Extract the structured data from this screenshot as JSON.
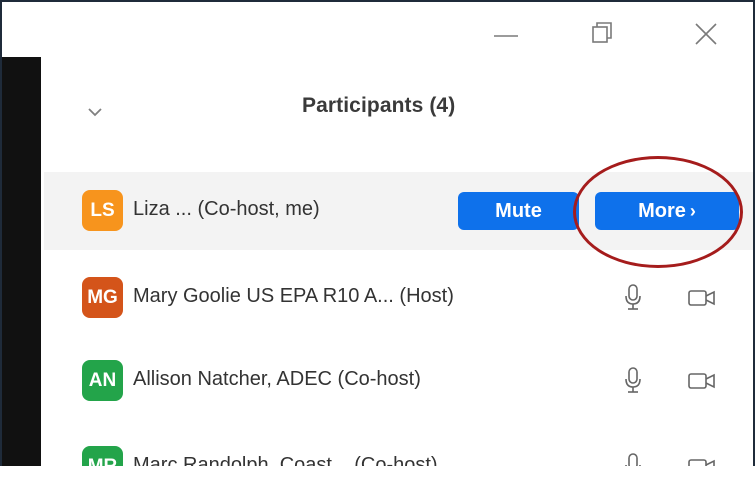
{
  "panel": {
    "title": "Participants (4)"
  },
  "window_controls": [
    "minimize",
    "maximize",
    "close"
  ],
  "participants": [
    {
      "initials": "LS",
      "name": "Liza ... (Co-host, me)",
      "avatar_color": "#f7941d",
      "highlighted": true,
      "actions": {
        "mute_label": "Mute",
        "more_label": "More",
        "more_chevron": "›"
      }
    },
    {
      "initials": "MG",
      "name": "Mary Goolie US EPA R10 A... (Host)",
      "avatar_color": "#d4541a",
      "icons": [
        "microphone-icon",
        "video-camera-icon"
      ]
    },
    {
      "initials": "AN",
      "name": "Allison Natcher, ADEC (Co-host)",
      "avatar_color": "#23a44a",
      "icons": [
        "microphone-icon",
        "video-camera-icon"
      ]
    },
    {
      "initials": "MR",
      "name": "Marc Randolph, Coast... (Co-host)",
      "avatar_color": "#23a44a",
      "icons": [
        "microphone-icon",
        "video-camera-icon"
      ]
    }
  ],
  "colors": {
    "accent": "#0e71eb",
    "annotation_ring": "#a51c1c"
  }
}
